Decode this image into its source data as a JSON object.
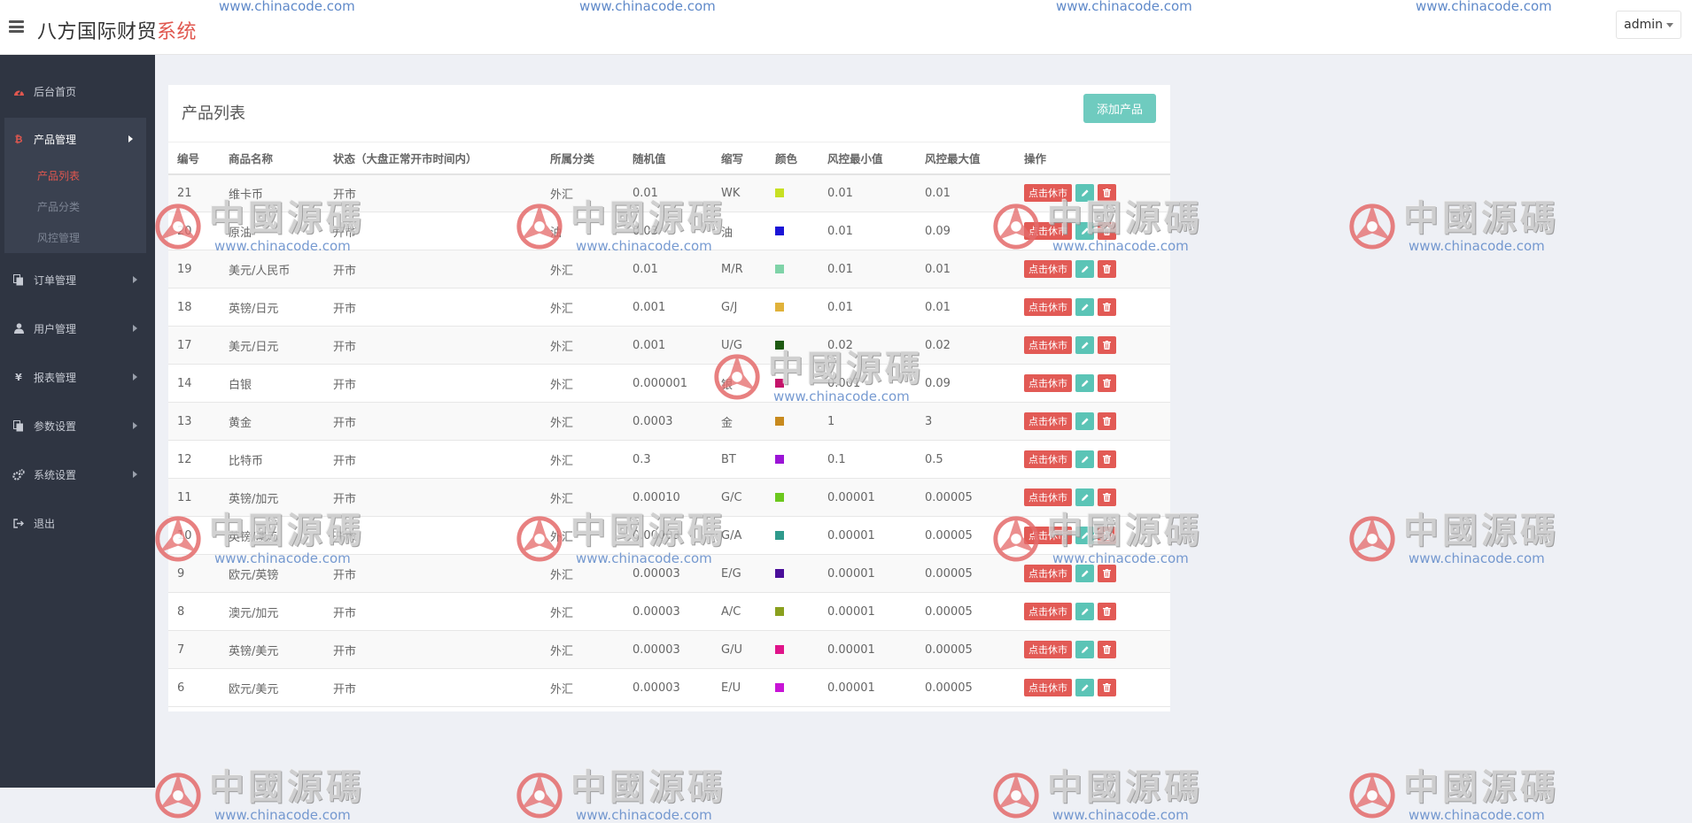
{
  "header": {
    "brand_main": "八方国际财贸",
    "brand_accent": "系统",
    "user": "admin"
  },
  "sidebar": {
    "items": [
      {
        "label": "后台首页",
        "icon": "dashboard-icon"
      },
      {
        "label": "产品管理",
        "icon": "bitcoin-icon"
      },
      {
        "label": "订单管理",
        "icon": "copy-icon"
      },
      {
        "label": "用户管理",
        "icon": "user-icon"
      },
      {
        "label": "报表管理",
        "icon": "yen-icon"
      },
      {
        "label": "参数设置",
        "icon": "copy-icon"
      },
      {
        "label": "系统设置",
        "icon": "cogs-icon"
      },
      {
        "label": "退出",
        "icon": "sign-out-icon"
      }
    ],
    "subitems": [
      {
        "label": "产品列表"
      },
      {
        "label": "产品分类"
      },
      {
        "label": "风控管理"
      }
    ]
  },
  "panel": {
    "title": "产品列表",
    "add_button": "添加产品"
  },
  "table": {
    "headers": [
      "编号",
      "商品名称",
      "状态（大盘正常开市时间内）",
      "所属分类",
      "随机值",
      "缩写",
      "颜色",
      "风控最小值",
      "风控最大值",
      "操作"
    ],
    "action_label": "点击休市",
    "rows": [
      {
        "id": "21",
        "name": "维卡币",
        "status": "开市",
        "category": "外汇",
        "random": "0.01",
        "abbr": "WK",
        "color": "#c8e023",
        "min": "0.01",
        "max": "0.01"
      },
      {
        "id": "20",
        "name": "原油",
        "status": "开市",
        "category": "油",
        "random": "0.03",
        "abbr": "油",
        "color": "#1b14d6",
        "min": "0.01",
        "max": "0.09"
      },
      {
        "id": "19",
        "name": "美元/人民币",
        "status": "开市",
        "category": "外汇",
        "random": "0.01",
        "abbr": "M/R",
        "color": "#7fd3a8",
        "min": "0.01",
        "max": "0.01"
      },
      {
        "id": "18",
        "name": "英镑/日元",
        "status": "开市",
        "category": "外汇",
        "random": "0.001",
        "abbr": "G/J",
        "color": "#e0b23a",
        "min": "0.01",
        "max": "0.01"
      },
      {
        "id": "17",
        "name": "美元/日元",
        "status": "开市",
        "category": "外汇",
        "random": "0.001",
        "abbr": "U/G",
        "color": "#1e5a12",
        "min": "0.02",
        "max": "0.02"
      },
      {
        "id": "14",
        "name": "白银",
        "status": "开市",
        "category": "外汇",
        "random": "0.000001",
        "abbr": "银",
        "color": "#c4146a",
        "min": "0.001",
        "max": "0.09"
      },
      {
        "id": "13",
        "name": "黄金",
        "status": "开市",
        "category": "外汇",
        "random": "0.0003",
        "abbr": "金",
        "color": "#c88a1e",
        "min": "1",
        "max": "3"
      },
      {
        "id": "12",
        "name": "比特币",
        "status": "开市",
        "category": "外汇",
        "random": "0.3",
        "abbr": "BT",
        "color": "#9b14d6",
        "min": "0.1",
        "max": "0.5"
      },
      {
        "id": "11",
        "name": "英镑/加元",
        "status": "开市",
        "category": "外汇",
        "random": "0.00010",
        "abbr": "G/C",
        "color": "#6cc81e",
        "min": "0.00001",
        "max": "0.00005"
      },
      {
        "id": "10",
        "name": "英镑/澳元",
        "status": "开市",
        "category": "外汇",
        "random": "0.00003",
        "abbr": "G/A",
        "color": "#2f9a8c",
        "min": "0.00001",
        "max": "0.00005"
      },
      {
        "id": "9",
        "name": "欧元/英镑",
        "status": "开市",
        "category": "外汇",
        "random": "0.00003",
        "abbr": "E/G",
        "color": "#4a0e9a",
        "min": "0.00001",
        "max": "0.00005"
      },
      {
        "id": "8",
        "name": "澳元/加元",
        "status": "开市",
        "category": "外汇",
        "random": "0.00003",
        "abbr": "A/C",
        "color": "#8aa01e",
        "min": "0.00001",
        "max": "0.00005"
      },
      {
        "id": "7",
        "name": "英镑/美元",
        "status": "开市",
        "category": "外汇",
        "random": "0.00003",
        "abbr": "G/U",
        "color": "#e0148a",
        "min": "0.00001",
        "max": "0.00005"
      },
      {
        "id": "6",
        "name": "欧元/美元",
        "status": "开市",
        "category": "外汇",
        "random": "0.00003",
        "abbr": "E/U",
        "color": "#c814d6",
        "min": "0.00001",
        "max": "0.00005"
      }
    ]
  },
  "watermark": {
    "cn": "中國源碼",
    "url": "www.chinacode.com"
  }
}
